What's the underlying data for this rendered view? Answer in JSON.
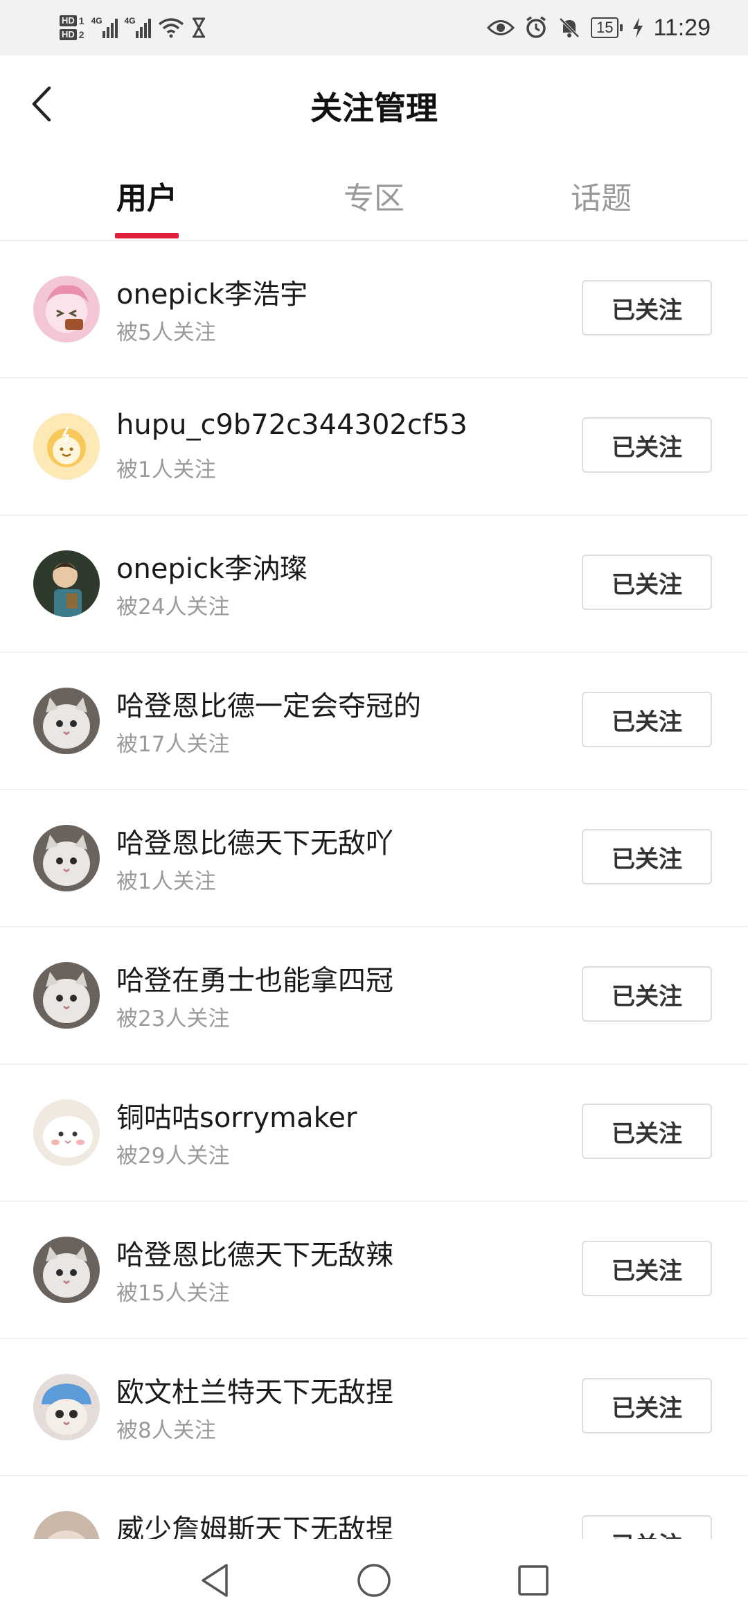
{
  "status_bar": {
    "time": "11:29",
    "battery": "15",
    "sim1": "HD",
    "sim1_num": "1",
    "sim2": "HD",
    "sim2_num": "2",
    "network1": "4G",
    "network2": "4G"
  },
  "header": {
    "title": "关注管理"
  },
  "tabs": [
    {
      "label": "用户",
      "active": true
    },
    {
      "label": "专区",
      "active": false
    },
    {
      "label": "话题",
      "active": false
    }
  ],
  "users": [
    {
      "name": "onepick李浩宇",
      "followers": "被5人关注",
      "button": "已关注"
    },
    {
      "name": "hupu_c9b72c344302cf53",
      "followers": "被1人关注",
      "button": "已关注"
    },
    {
      "name": "onepick李汭璨",
      "followers": "被24人关注",
      "button": "已关注"
    },
    {
      "name": "哈登恩比德一定会夺冠的",
      "followers": "被17人关注",
      "button": "已关注"
    },
    {
      "name": "哈登恩比德天下无敌吖",
      "followers": "被1人关注",
      "button": "已关注"
    },
    {
      "name": "哈登在勇士也能拿四冠",
      "followers": "被23人关注",
      "button": "已关注"
    },
    {
      "name": "铜咕咕sorrymaker",
      "followers": "被29人关注",
      "button": "已关注"
    },
    {
      "name": "哈登恩比德天下无敌辣",
      "followers": "被15人关注",
      "button": "已关注"
    },
    {
      "name": "欧文杜兰特天下无敌捏",
      "followers": "被8人关注",
      "button": "已关注"
    },
    {
      "name": "威少詹姆斯天下无敌捏",
      "followers": "",
      "button": "已关注"
    }
  ],
  "colors": {
    "accent": "#e0203a",
    "muted_text": "#9a9a9a",
    "border": "#dddddd"
  }
}
